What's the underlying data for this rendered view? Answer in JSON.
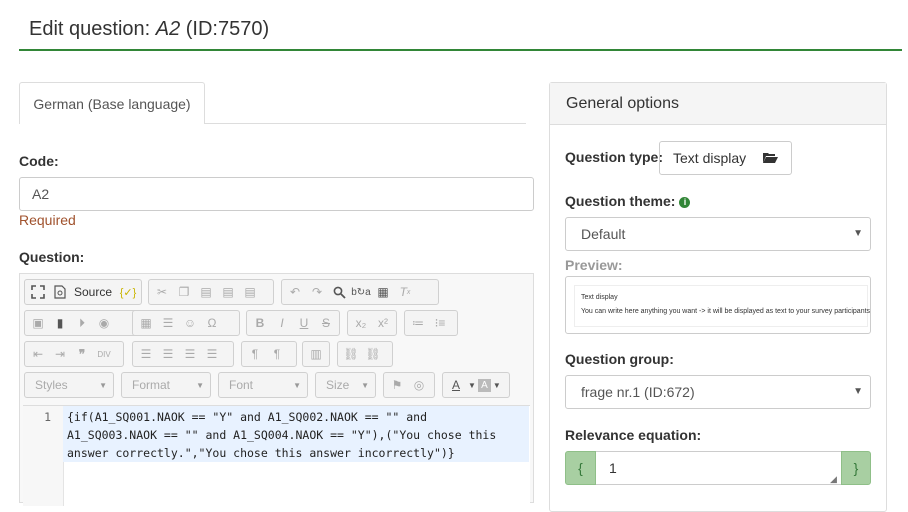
{
  "page": {
    "title_prefix": "Edit question: ",
    "question_code": "A2",
    "question_id": " (ID:7570)"
  },
  "language_tab": {
    "label": "German (Base language)"
  },
  "code_field": {
    "label": "Code:",
    "value": "A2",
    "validation": "Required"
  },
  "question_field": {
    "label": "Question:"
  },
  "toolbar": {
    "source_label": "Source",
    "styles_combo": "Styles",
    "format_combo": "Format",
    "font_combo": "Font",
    "size_combo": "Size"
  },
  "code_editor": {
    "line_number": "1",
    "lines": [
      "{if(A1_SQ001.NAOK == \"Y\" and A1_SQ002.NAOK == \"\" and",
      "A1_SQ003.NAOK == \"\" and A1_SQ004.NAOK == \"Y\"),(\"You chose this",
      "answer correctly.\",\"You chose this answer incorrectly\")}"
    ]
  },
  "general_options": {
    "heading": "General options",
    "question_type_label": "Question type:",
    "question_type_value": "Text display",
    "question_theme_label": "Question theme:",
    "question_theme_value": "Default",
    "preview_label": "Preview:",
    "preview_title": "Text display",
    "preview_text": "You can write here anything you want -> it will be displayed as text to your survey participants",
    "question_group_label": "Question group:",
    "question_group_value": "frage nr.1 (ID:672)",
    "relevance_label": "Relevance equation:",
    "relevance_open": "{",
    "relevance_value": "1",
    "relevance_close": "}"
  },
  "colors": {
    "accent": "#328637",
    "required": "#a0522d"
  }
}
